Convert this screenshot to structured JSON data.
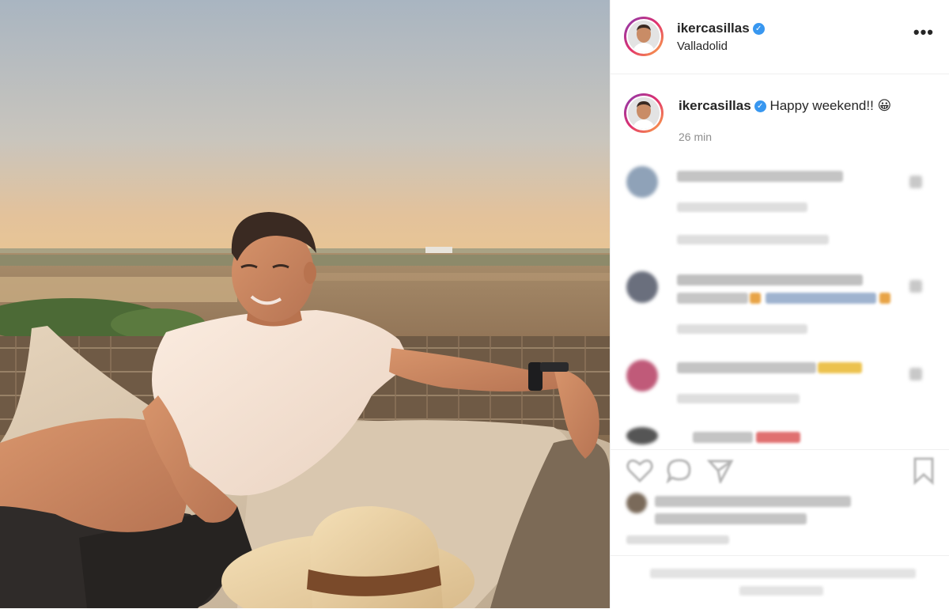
{
  "post": {
    "username": "ikercasillas",
    "location": "Valladolid",
    "verified_icon": "✓",
    "more_icon": "•••"
  },
  "caption": {
    "username": "ikercasillas",
    "text": "Happy weekend!! 😀",
    "time": "26 min"
  },
  "colors": {
    "verified": "#3897f0",
    "border": "#efefef",
    "muted": "#8e8e8e"
  },
  "icons": [
    "more-options-icon",
    "verified-badge-icon",
    "heart-icon",
    "comment-icon",
    "share-icon",
    "bookmark-icon"
  ]
}
